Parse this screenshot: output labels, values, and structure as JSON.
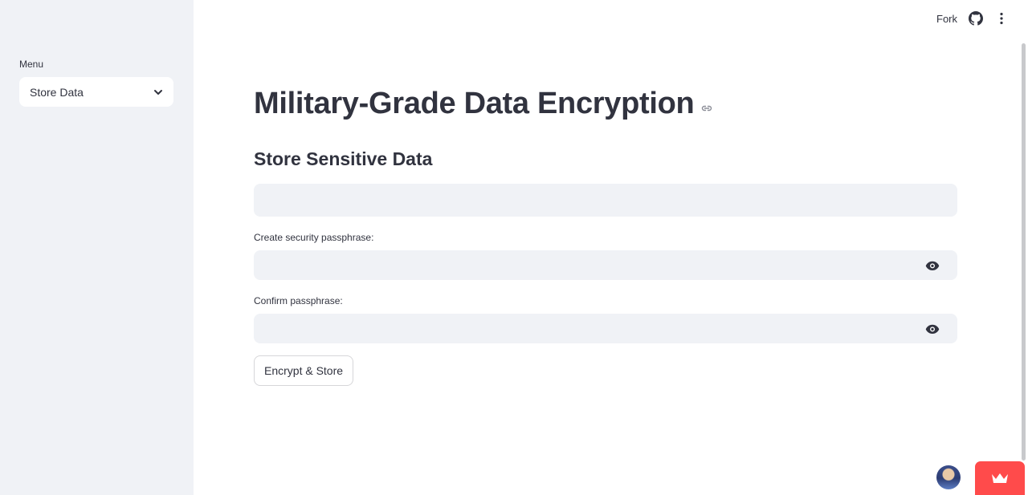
{
  "sidebar": {
    "menu_label": "Menu",
    "selected_option": "Store Data"
  },
  "toolbar": {
    "fork_label": "Fork",
    "icons": [
      "github-icon",
      "more-vertical-icon"
    ]
  },
  "main": {
    "title": "Military-Grade Data Encryption",
    "subheader": "Store Sensitive Data",
    "data_input": {
      "value": "",
      "placeholder": ""
    },
    "passphrase": {
      "label": "Create security passphrase:",
      "value": ""
    },
    "confirm": {
      "label": "Confirm passphrase:",
      "value": ""
    },
    "submit_label": "Encrypt & Store"
  },
  "colors": {
    "accent": "#ff4b4b",
    "sidebar_bg": "#f0f2f6",
    "text": "#31333f"
  }
}
